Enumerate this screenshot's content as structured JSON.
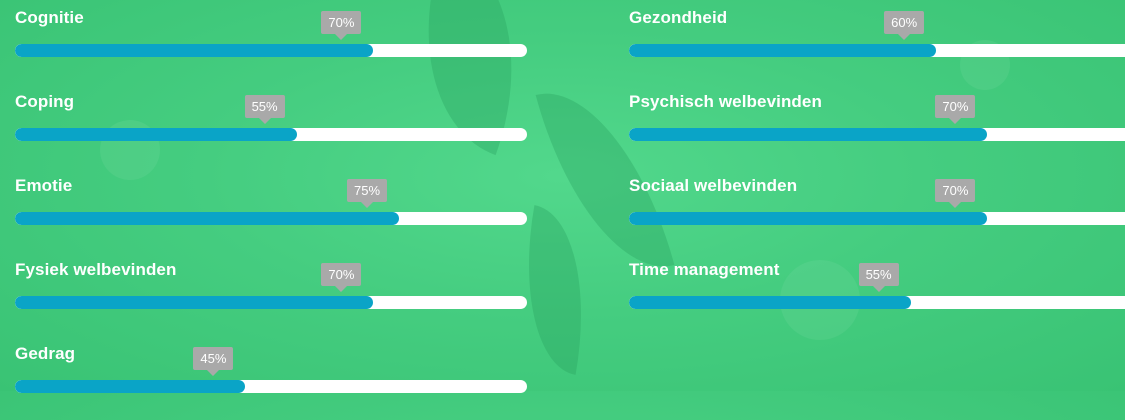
{
  "colors": {
    "bar_fill": "#0aa4c7",
    "bar_track": "#ffffff",
    "tooltip_bg": "#a9a9a9",
    "background": "#45cd80"
  },
  "left_skills": [
    {
      "label": "Cognitie",
      "value_text": "70%",
      "value": 70
    },
    {
      "label": "Coping",
      "value_text": "55%",
      "value": 55
    },
    {
      "label": "Emotie",
      "value_text": "75%",
      "value": 75
    },
    {
      "label": "Fysiek welbevinden",
      "value_text": "70%",
      "value": 70
    },
    {
      "label": "Gedrag",
      "value_text": "45%",
      "value": 45
    }
  ],
  "right_skills": [
    {
      "label": "Gezondheid",
      "value_text": "60%",
      "value": 60
    },
    {
      "label": "Psychisch welbevinden",
      "value_text": "70%",
      "value": 70
    },
    {
      "label": "Sociaal welbevinden",
      "value_text": "70%",
      "value": 70
    },
    {
      "label": "Time management",
      "value_text": "55%",
      "value": 55
    }
  ]
}
